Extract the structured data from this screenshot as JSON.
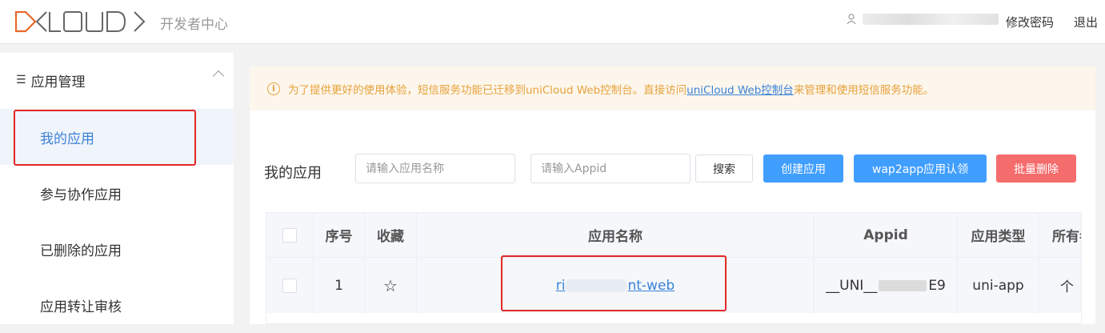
{
  "header": {
    "logo_text": "DCLOUD",
    "subtitle": "开发者中心",
    "change_password": "修改密码",
    "logout": "退出"
  },
  "sidebar": {
    "section_title": "应用管理",
    "items": [
      {
        "label": "我的应用",
        "active": true
      },
      {
        "label": "参与协作应用",
        "active": false
      },
      {
        "label": "已删除的应用",
        "active": false
      },
      {
        "label": "应用转让审核",
        "active": false
      }
    ]
  },
  "notice": {
    "text_before": "为了提供更好的使用体验，短信服务功能已迁移到uniCloud Web控制台。直接访问",
    "link": "uniCloud Web控制台",
    "text_after": "来管理和使用短信服务功能。"
  },
  "toolbar": {
    "title": "我的应用",
    "name_placeholder": "请输入应用名称",
    "appid_placeholder": "请输入Appid",
    "search": "搜索",
    "create": "创建应用",
    "wap2app": "wap2app应用认领",
    "batch_delete": "批量删除"
  },
  "table": {
    "columns": [
      "序号",
      "收藏",
      "应用名称",
      "Appid",
      "应用类型",
      "所有者"
    ],
    "rows": [
      {
        "index": "1",
        "name_prefix": "ri",
        "name_suffix": "nt-web",
        "appid_prefix": "__UNI__",
        "appid_suffix": "E9",
        "type": "uni-app",
        "owner": "个"
      }
    ]
  },
  "colors": {
    "accent": "#409eff",
    "danger": "#f56c6c",
    "warning": "#e6a23c",
    "highlight_box": "#e32727"
  }
}
